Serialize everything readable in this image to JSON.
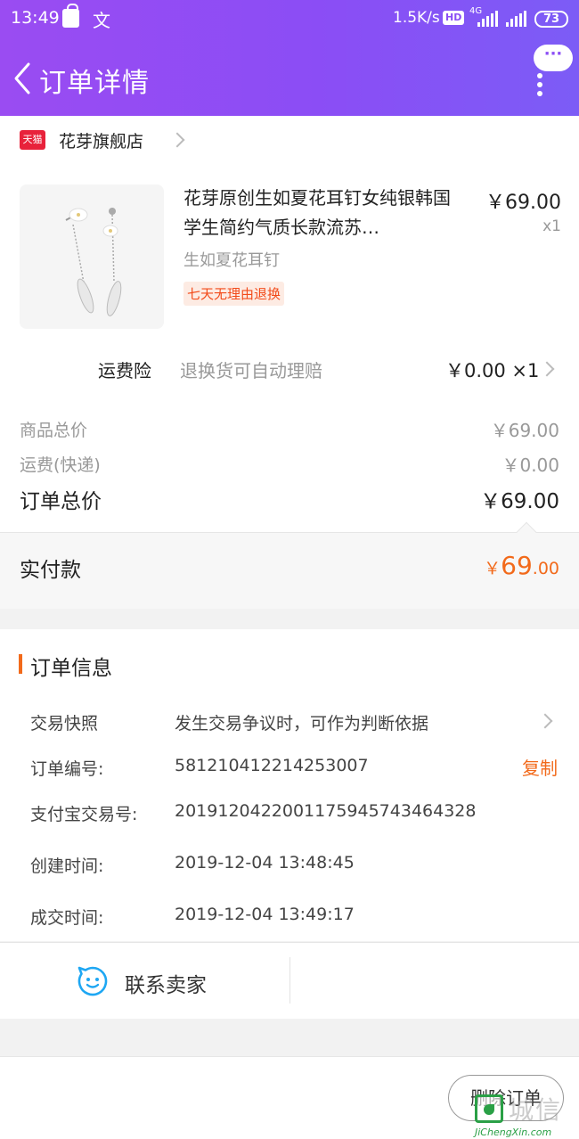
{
  "status_bar": {
    "time": "13:49",
    "lang_icon": "文",
    "speed": "1.5K/s",
    "hd": "HD",
    "net": "4G",
    "battery": "73"
  },
  "header": {
    "title": "订单详情",
    "more_dots": "···",
    "accent_color": "#8b4df5"
  },
  "store": {
    "badge": "天猫",
    "name": "花芽旗舰店"
  },
  "product": {
    "title": "花芽原创生如夏花耳钉女纯银韩国学生简约气质长款流苏…",
    "sku": "生如夏花耳钉",
    "tag": "七天无理由退换",
    "price": "￥69.00",
    "qty": "x1"
  },
  "insurance": {
    "label": "运费险",
    "desc": "退换货可自动理赔",
    "value": "￥0.00 ×1"
  },
  "summary": {
    "goods_label": "商品总价",
    "goods_value": "￥69.00",
    "shipping_label": "运费(快递)",
    "shipping_value": "￥0.00",
    "total_label": "订单总价",
    "total_value": "￥69.00"
  },
  "paid": {
    "label": "实付款",
    "currency": "￥",
    "int": "69",
    "dec": ".00",
    "color": "#f26a1b"
  },
  "order_info": {
    "title": "订单信息",
    "snapshot_label": "交易快照",
    "snapshot_value": "发生交易争议时，可作为判断依据",
    "order_no_label": "订单编号:",
    "order_no": "581210412214253007",
    "copy": "复制",
    "alipay_label": "支付宝交易号:",
    "alipay_no": "2019120422001175945743464328",
    "created_label": "创建时间:",
    "created": "2019-12-04 13:48:45",
    "done_label": "成交时间:",
    "done": "2019-12-04 13:49:17"
  },
  "contact": {
    "label": "联系卖家"
  },
  "actions": {
    "delete": "删除订单"
  },
  "watermark": {
    "cn": "城信",
    "en": "JiChengXin.com"
  }
}
